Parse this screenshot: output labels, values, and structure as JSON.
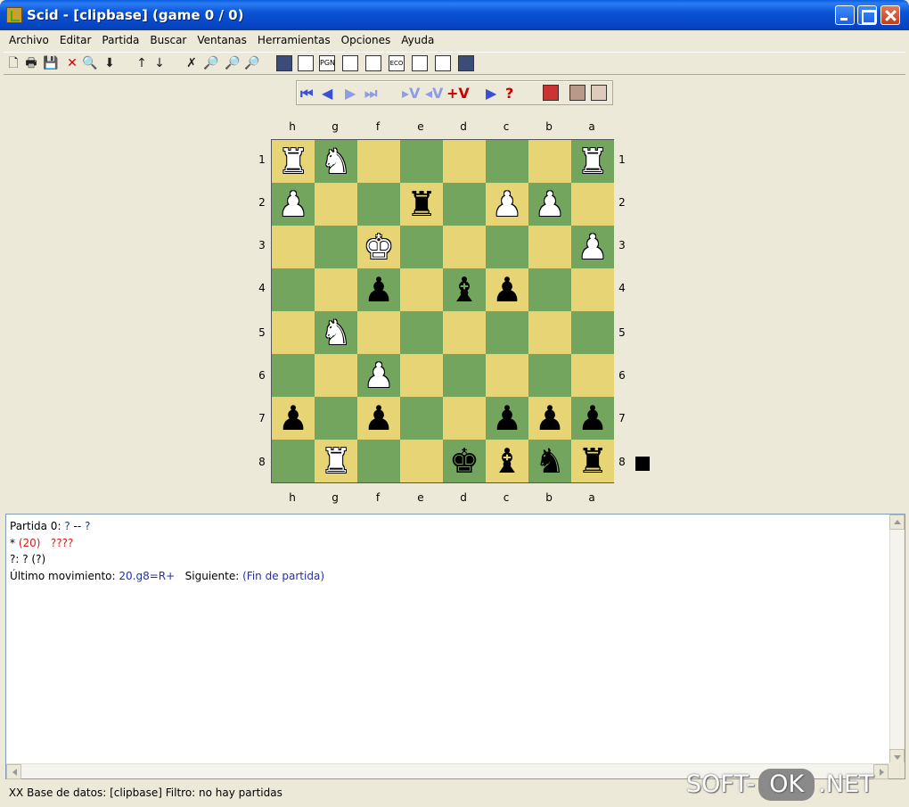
{
  "window": {
    "title": "Scid - [clipbase] (game 0 / 0)"
  },
  "menu": [
    "Archivo",
    "Editar",
    "Partida",
    "Buscar",
    "Ventanas",
    "Herramientas",
    "Opciones",
    "Ayuda"
  ],
  "toolbar": {
    "icons": [
      "new-file-icon",
      "open-icon",
      "save-icon",
      "close-icon",
      "find-icon",
      "import-icon",
      "up-icon",
      "down-icon",
      "board-search-icon",
      "header-search-icon",
      "material-search-icon",
      "player-search-icon",
      "gamelist-icon",
      "game-info-icon",
      "pgn-icon",
      "crosstable-icon",
      "tree-icon",
      "eco-icon",
      "analysis-icon",
      "tournament-icon",
      "train-icon"
    ],
    "pgn_label": "PGN",
    "eco_label": "ECO"
  },
  "nav": {
    "start": "⏮",
    "back": "◀",
    "forward": "▶",
    "end": "⏭",
    "var_enter": "▸V",
    "var_exit": "◂V",
    "var_add": "+V",
    "auto_play": "▶",
    "trial": "?"
  },
  "board": {
    "files": [
      "h",
      "g",
      "f",
      "e",
      "d",
      "c",
      "b",
      "a"
    ],
    "ranks": [
      "1",
      "2",
      "3",
      "4",
      "5",
      "6",
      "7",
      "8"
    ],
    "squares": [
      [
        {
          "p": "♜",
          "c": "w"
        },
        {
          "p": "♞",
          "c": "w"
        },
        {
          "p": "",
          "c": ""
        },
        {
          "p": "",
          "c": ""
        },
        {
          "p": "",
          "c": ""
        },
        {
          "p": "",
          "c": ""
        },
        {
          "p": "",
          "c": ""
        },
        {
          "p": "♜",
          "c": "w"
        }
      ],
      [
        {
          "p": "♟",
          "c": "w"
        },
        {
          "p": "",
          "c": ""
        },
        {
          "p": "",
          "c": ""
        },
        {
          "p": "♜",
          "c": "b"
        },
        {
          "p": "",
          "c": ""
        },
        {
          "p": "♟",
          "c": "w"
        },
        {
          "p": "♟",
          "c": "w"
        },
        {
          "p": "",
          "c": ""
        }
      ],
      [
        {
          "p": "",
          "c": ""
        },
        {
          "p": "",
          "c": ""
        },
        {
          "p": "♚",
          "c": "w"
        },
        {
          "p": "",
          "c": ""
        },
        {
          "p": "",
          "c": ""
        },
        {
          "p": "",
          "c": ""
        },
        {
          "p": "",
          "c": ""
        },
        {
          "p": "♟",
          "c": "w"
        }
      ],
      [
        {
          "p": "",
          "c": ""
        },
        {
          "p": "",
          "c": ""
        },
        {
          "p": "♟",
          "c": "b"
        },
        {
          "p": "",
          "c": ""
        },
        {
          "p": "♝",
          "c": "b"
        },
        {
          "p": "♟",
          "c": "b"
        },
        {
          "p": "",
          "c": ""
        },
        {
          "p": "",
          "c": ""
        }
      ],
      [
        {
          "p": "",
          "c": ""
        },
        {
          "p": "♞",
          "c": "w"
        },
        {
          "p": "",
          "c": ""
        },
        {
          "p": "",
          "c": ""
        },
        {
          "p": "",
          "c": ""
        },
        {
          "p": "",
          "c": ""
        },
        {
          "p": "",
          "c": ""
        },
        {
          "p": "",
          "c": ""
        }
      ],
      [
        {
          "p": "",
          "c": ""
        },
        {
          "p": "",
          "c": ""
        },
        {
          "p": "♟",
          "c": "w"
        },
        {
          "p": "",
          "c": ""
        },
        {
          "p": "",
          "c": ""
        },
        {
          "p": "",
          "c": ""
        },
        {
          "p": "",
          "c": ""
        },
        {
          "p": "",
          "c": ""
        }
      ],
      [
        {
          "p": "♟",
          "c": "b"
        },
        {
          "p": "",
          "c": ""
        },
        {
          "p": "♟",
          "c": "b"
        },
        {
          "p": "",
          "c": ""
        },
        {
          "p": "",
          "c": ""
        },
        {
          "p": "♟",
          "c": "b"
        },
        {
          "p": "♟",
          "c": "b"
        },
        {
          "p": "♟",
          "c": "b"
        }
      ],
      [
        {
          "p": "",
          "c": ""
        },
        {
          "p": "♜",
          "c": "w"
        },
        {
          "p": "",
          "c": ""
        },
        {
          "p": "",
          "c": ""
        },
        {
          "p": "♚",
          "c": "b"
        },
        {
          "p": "♝",
          "c": "b"
        },
        {
          "p": "♞",
          "c": "b"
        },
        {
          "p": "♜",
          "c": "b"
        }
      ]
    ],
    "side_to_move": "black"
  },
  "info": {
    "game_label": "Partida 0:",
    "white": "?",
    "sep": "--",
    "black": "?",
    "result": "*",
    "moves": "(20)",
    "eco": "????",
    "event": "?:",
    "site": "? (?)",
    "last_move_label": "Último movimiento:",
    "last_move": "20.g8=R+",
    "next_label": "Siguiente:",
    "next": "(Fin de partida)"
  },
  "status": {
    "prefix": "XX",
    "text": "Base de datos: [clipbase]   Filtro: no hay partidas"
  },
  "watermark": {
    "left": "SOFT-",
    "mid": "OK",
    "right": ".NET"
  },
  "colors": {
    "light_square": "#E6D475",
    "dark_square": "#74A55F",
    "link_blue": "#1F2FB4",
    "red": "#D41B1B"
  }
}
